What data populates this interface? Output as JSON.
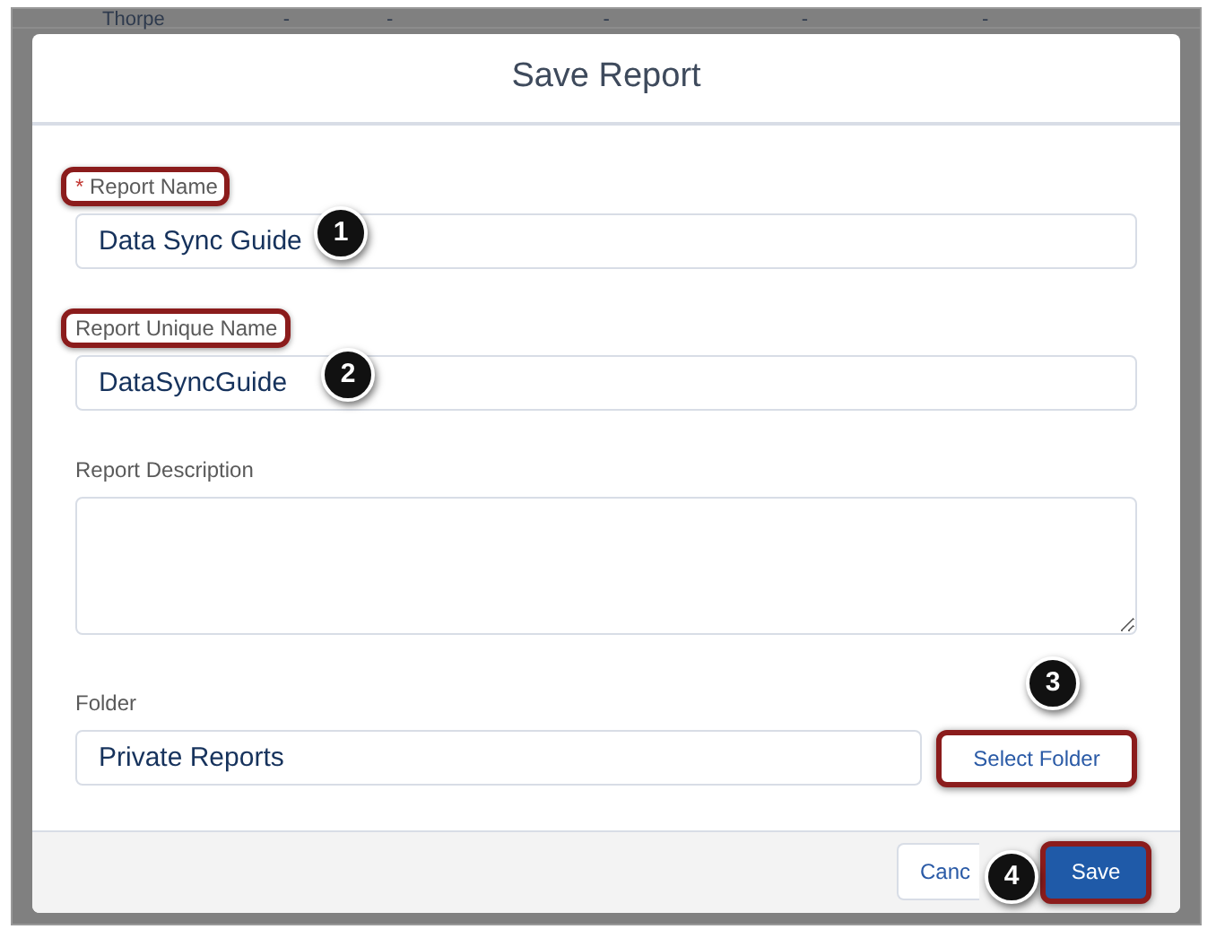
{
  "background_table": {
    "rows": [
      {
        "cells": [
          "Thorpe",
          "-",
          "-",
          "-",
          "-",
          "-"
        ]
      }
    ]
  },
  "dialog": {
    "title": "Save Report",
    "fields": [
      {
        "kind": "input",
        "label": "Report Name",
        "required_mark": "*",
        "value": "Data Sync Guide",
        "highlighted": true,
        "callout": "1"
      },
      {
        "kind": "input",
        "label": "Report Unique Name",
        "value": "DataSyncGuide",
        "highlighted": true,
        "callout": "2"
      },
      {
        "kind": "textarea",
        "label": "Report Description",
        "highlighted": false
      },
      {
        "kind": "folder",
        "label": "Folder",
        "value": "Private Reports",
        "highlighted": false,
        "button": {
          "label": "Select Folder",
          "highlighted": true,
          "callout": "3"
        }
      }
    ],
    "footer_buttons": [
      {
        "kind": "neutral",
        "label": "Canc",
        "highlighted": false
      },
      {
        "kind": "brand",
        "label": "Save",
        "highlighted": true,
        "callout": "4"
      }
    ]
  }
}
